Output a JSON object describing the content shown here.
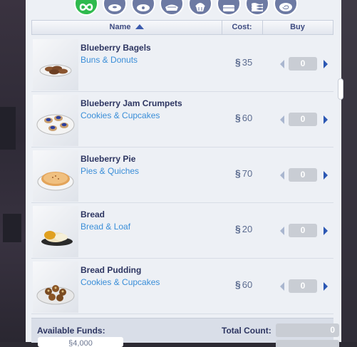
{
  "categories": [
    {
      "icon": "infinity-icon",
      "active": true
    },
    {
      "icon": "bagel-icon",
      "active": false
    },
    {
      "icon": "donut-icon",
      "active": false
    },
    {
      "icon": "pie-icon",
      "active": false
    },
    {
      "icon": "cupcake-icon",
      "active": false
    },
    {
      "icon": "cake-icon",
      "active": false
    },
    {
      "icon": "layer-cake-icon",
      "active": false
    },
    {
      "icon": "swirl-icon",
      "active": false
    }
  ],
  "header": {
    "name": "Name",
    "cost": "Cost:",
    "buy": "Buy"
  },
  "currency_symbol": "§",
  "items": [
    {
      "name": "Blueberry Bagels",
      "category": "Buns & Donuts",
      "cost": "35",
      "qty": "0"
    },
    {
      "name": "Blueberry Jam Crumpets",
      "category": "Cookies & Cupcakes",
      "cost": "60",
      "qty": "0"
    },
    {
      "name": "Blueberry Pie",
      "category": "Pies & Quiches",
      "cost": "70",
      "qty": "0"
    },
    {
      "name": "Bread",
      "category": "Bread & Loaf",
      "cost": "20",
      "qty": "0"
    },
    {
      "name": "Bread Pudding",
      "category": "Cookies & Cupcakes",
      "cost": "60",
      "qty": "0"
    }
  ],
  "footer": {
    "funds_label": "Available Funds:",
    "funds_value": "§4,000",
    "total_label": "Total Count:",
    "total_value": "0"
  },
  "colors": {
    "accent": "#2b57b3",
    "active_category": "#2fba4e",
    "category": "#6d7aa3",
    "item_name": "#2d3561",
    "item_category": "#3a8ed8"
  }
}
